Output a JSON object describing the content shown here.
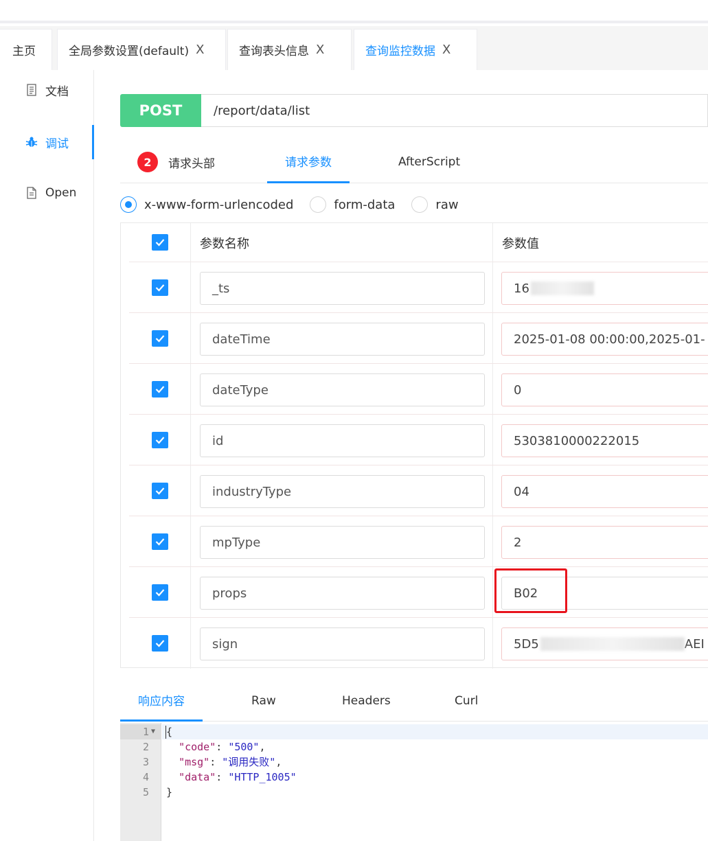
{
  "tabs": [
    {
      "label": "主页",
      "closable": false,
      "active": false
    },
    {
      "label": "全局参数设置(default)",
      "closable": true,
      "active": false
    },
    {
      "label": "查询表头信息",
      "closable": true,
      "active": false
    },
    {
      "label": "查询监控数据",
      "closable": true,
      "active": true
    }
  ],
  "tab_close_glyph": "X",
  "sidebar": {
    "items": [
      {
        "label": "文档",
        "icon": "document-icon"
      },
      {
        "label": "调试",
        "icon": "bug-icon",
        "active": true
      },
      {
        "label": "Open",
        "icon": "file-icon"
      }
    ]
  },
  "request": {
    "method": "POST",
    "url": "/report/data/list"
  },
  "request_tabs": {
    "headers_badge": "2",
    "headers_label": "请求头部",
    "params_label": "请求参数",
    "afterscript_label": "AfterScript",
    "active": "params"
  },
  "body_types": {
    "options": [
      "x-www-form-urlencoded",
      "form-data",
      "raw"
    ],
    "selected": "x-www-form-urlencoded"
  },
  "params_table": {
    "headers": {
      "name": "参数名称",
      "value": "参数值"
    },
    "rows": [
      {
        "name": "_ts",
        "value": "16",
        "checked": true,
        "value_redacted": true
      },
      {
        "name": "dateTime",
        "value": "2025-01-08 00:00:00,2025-01-",
        "checked": true
      },
      {
        "name": "dateType",
        "value": "0",
        "checked": true
      },
      {
        "name": "id",
        "value": "5303810000222015",
        "checked": true
      },
      {
        "name": "industryType",
        "value": "04",
        "checked": true
      },
      {
        "name": "mpType",
        "value": "2",
        "checked": true
      },
      {
        "name": "props",
        "value": "B02",
        "checked": true,
        "highlighted": true
      },
      {
        "name": "sign",
        "value": "5D5",
        "value_suffix": "AEI",
        "checked": true,
        "value_redacted": true
      }
    ]
  },
  "response_tabs": {
    "content": "响应内容",
    "raw": "Raw",
    "headers": "Headers",
    "curl": "Curl",
    "active": "content"
  },
  "response_body": {
    "line_numbers": [
      "1",
      "2",
      "3",
      "4",
      "5"
    ],
    "open_brace": "{",
    "close_brace": "}",
    "fields": [
      {
        "key": "\"code\"",
        "value": "\"500\"",
        "comma": ","
      },
      {
        "key": "\"msg\"",
        "value": "\"调用失败\"",
        "comma": ","
      },
      {
        "key": "\"data\"",
        "value": "\"HTTP_1005\"",
        "comma": ""
      }
    ]
  },
  "colors": {
    "accent": "#1890ff",
    "post_badge": "#4ccf8a",
    "badge_red": "#f5222d",
    "highlight_red": "#e8141d"
  }
}
